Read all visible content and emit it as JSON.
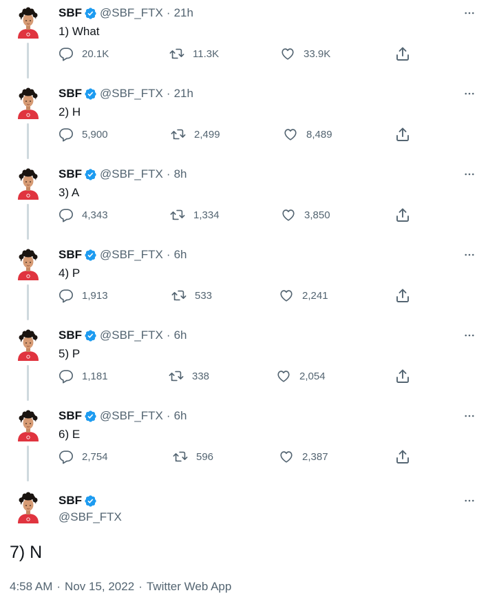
{
  "author": {
    "name": "SBF",
    "handle": "@SBF_FTX"
  },
  "separator": "·",
  "tweets": [
    {
      "time": "21h",
      "text": "1) What",
      "replies": "20.1K",
      "retweets": "11.3K",
      "likes": "33.9K"
    },
    {
      "time": "21h",
      "text": "2) H",
      "replies": "5,900",
      "retweets": "2,499",
      "likes": "8,489"
    },
    {
      "time": "8h",
      "text": "3) A",
      "replies": "4,343",
      "retweets": "1,334",
      "likes": "3,850"
    },
    {
      "time": "6h",
      "text": "4) P",
      "replies": "1,913",
      "retweets": "533",
      "likes": "2,241"
    },
    {
      "time": "6h",
      "text": "5) P",
      "replies": "1,181",
      "retweets": "338",
      "likes": "2,054"
    },
    {
      "time": "6h",
      "text": "6) E",
      "replies": "2,754",
      "retweets": "596",
      "likes": "2,387"
    }
  ],
  "main_tweet": {
    "text": "7) N",
    "time": "4:58 AM",
    "date": "Nov 15, 2022",
    "source": "Twitter Web App"
  },
  "colors": {
    "verified": "#1d9bf0",
    "secondary_text": "#536471",
    "thread_line": "#cfd9de",
    "shirt": "#e0343f"
  },
  "icons": [
    "verified-badge-icon",
    "more-icon",
    "reply-icon",
    "retweet-icon",
    "like-icon",
    "share-icon"
  ]
}
